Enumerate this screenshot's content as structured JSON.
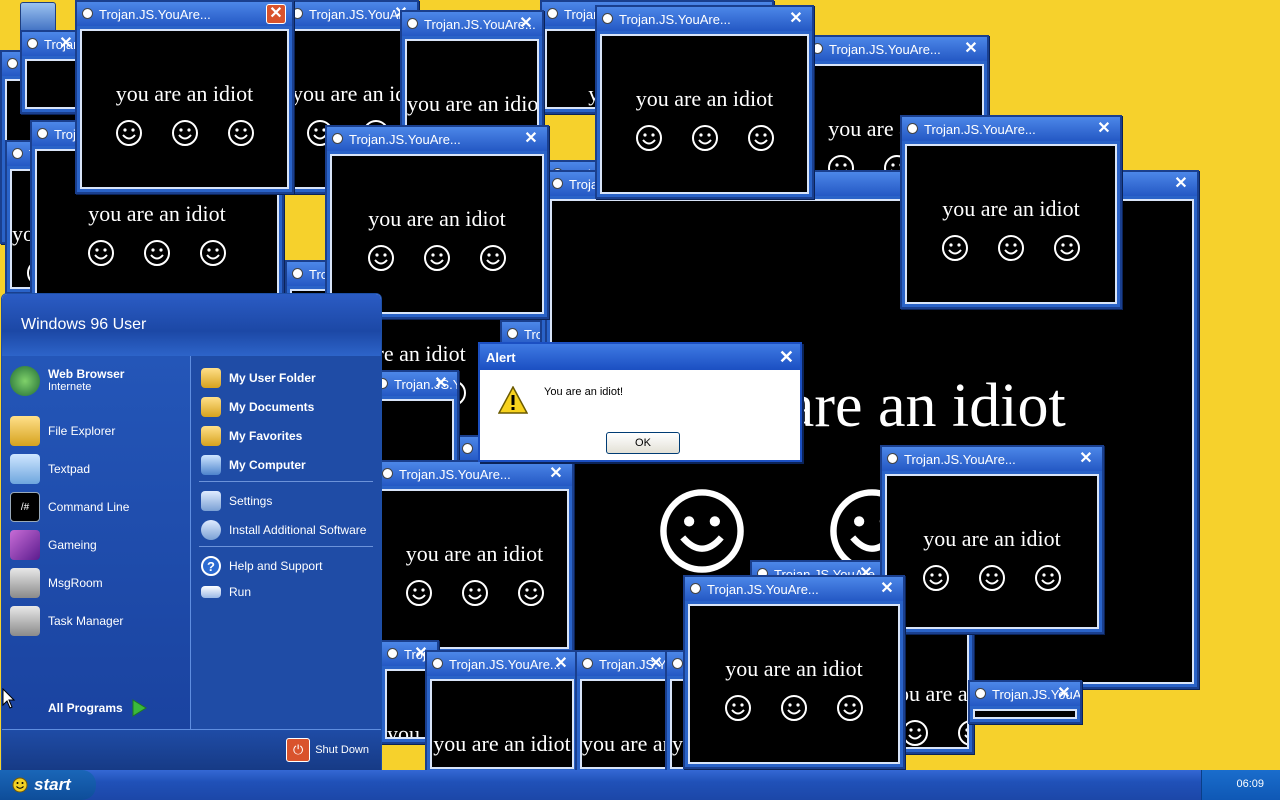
{
  "trojan": {
    "title": "Trojan.JS.YouAre...",
    "message": "you are an idiot"
  },
  "alert": {
    "title": "Alert",
    "message": "You are an idiot!",
    "ok": "OK"
  },
  "start_menu": {
    "user": "Windows 96 User",
    "left_items": [
      {
        "label": "Web Browser",
        "sub": "Internete"
      },
      {
        "label": "File Explorer"
      },
      {
        "label": "Textpad"
      },
      {
        "label": "Command Line"
      },
      {
        "label": "Gameing"
      },
      {
        "label": "MsgRoom"
      },
      {
        "label": "Task Manager"
      }
    ],
    "right_items": [
      {
        "label": "My User Folder"
      },
      {
        "label": "My Documents"
      },
      {
        "label": "My Favorites"
      },
      {
        "label": "My Computer"
      },
      {
        "label": "Settings"
      },
      {
        "label": "Install Additional Software"
      },
      {
        "label": "Help and Support"
      },
      {
        "label": "Run"
      }
    ],
    "all_programs": "All Programs",
    "shut_down": "Shut Down"
  },
  "taskbar": {
    "start": "start",
    "clock": "06:09"
  },
  "colors": {
    "desktop": "#f6d12c",
    "window_blue": "#2a63c8",
    "start_menu_blue": "#1f4ca6"
  }
}
